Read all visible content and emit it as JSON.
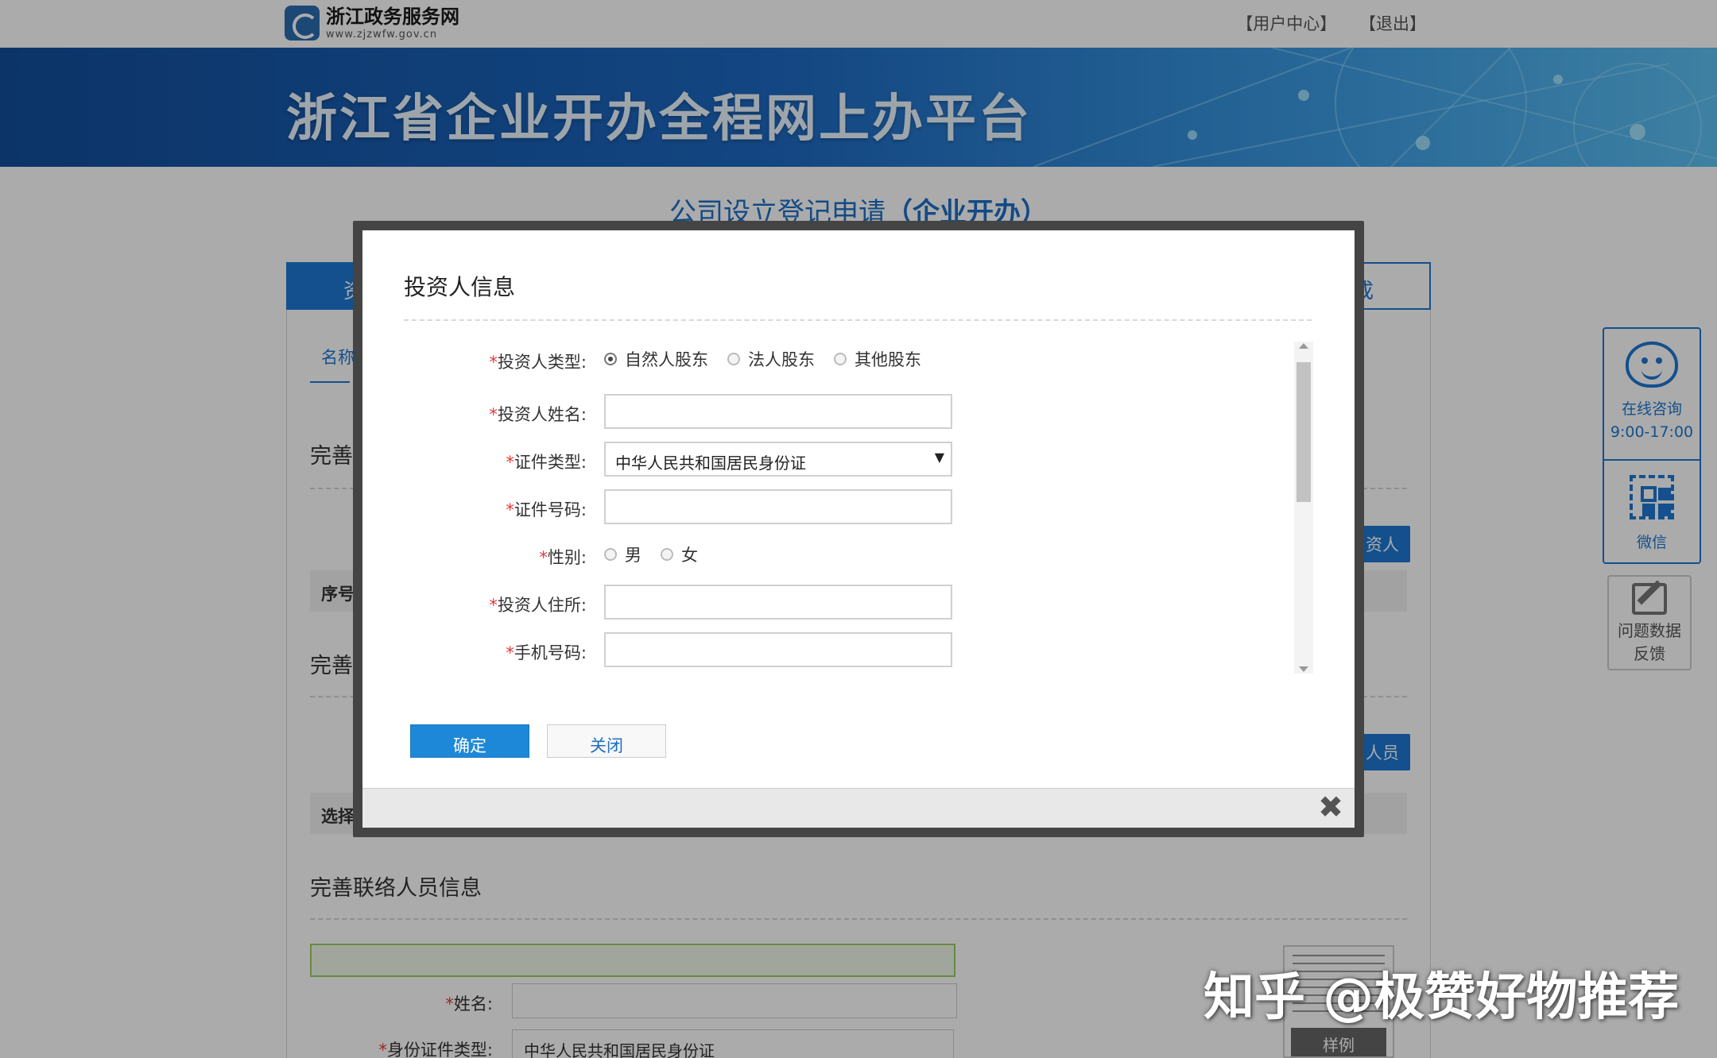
{
  "header": {
    "logo_cn": "浙江政务服务网",
    "logo_url": "www.zjzwfw.gov.cn",
    "links": [
      "【用户中心】",
      "【退出】"
    ]
  },
  "banner": {
    "title": "浙江省企业开办全程网上办平台"
  },
  "page": {
    "title_main": "公司设立登记申请",
    "title_paren": "（企业开办）",
    "tab_active_partial": "资",
    "tab_end_partial": "成",
    "step_label_partial": "名称",
    "sections": {
      "investor_partial": "完善",
      "table1_header_partial": "序号",
      "add_investor_partial": "资人",
      "staff_partial": "完善",
      "add_staff_partial": "人员",
      "table2_header_partial": "选择",
      "contact_title": "完善联络人员信息"
    },
    "contact_form": {
      "name_label": "姓名:",
      "id_type_label": "身份证件类型:",
      "id_type_value": "中华人民共和国居民身份证"
    },
    "sample_label": "样例"
  },
  "side": {
    "consult_label": "在线咨询",
    "consult_hours": "9:00-17:00",
    "wechat_label": "微信",
    "feedback_line1": "问题数据",
    "feedback_line2": "反馈"
  },
  "modal": {
    "title": "投资人信息",
    "fields": {
      "investor_type": {
        "label": "投资人类型:",
        "options": [
          "自然人股东",
          "法人股东",
          "其他股东"
        ],
        "selected": "自然人股东"
      },
      "investor_name": {
        "label": "投资人姓名:",
        "value": ""
      },
      "id_type": {
        "label": "证件类型:",
        "value": "中华人民共和国居民身份证"
      },
      "id_number": {
        "label": "证件号码:",
        "value": ""
      },
      "gender": {
        "label": "性别:",
        "options": [
          "男",
          "女"
        ]
      },
      "address": {
        "label": "投资人住所:",
        "value": ""
      },
      "phone": {
        "label": "手机号码:",
        "value": ""
      }
    },
    "required_mark": "*",
    "confirm_label": "确定",
    "close_label": "关闭"
  },
  "watermark": "知乎 @极赞好物推荐",
  "colors": {
    "primary": "#1d78d2",
    "required": "#e53935",
    "confirm_button": "#1e88d8"
  }
}
